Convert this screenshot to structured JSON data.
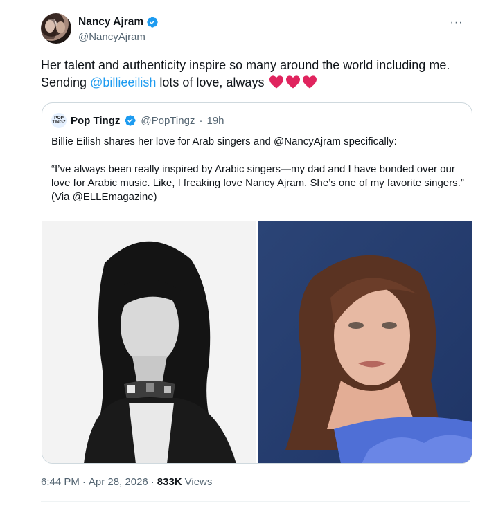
{
  "author": {
    "name": "Nancy Ajram",
    "handle": "@NancyAjram"
  },
  "tweet": {
    "text_before": "Her talent and authenticity inspire so many around the world including me. Sending ",
    "mention": "@billieeilish",
    "text_after": " lots of love, always",
    "emoji": [
      "heart",
      "heart",
      "heart"
    ]
  },
  "more_label": "···",
  "quote": {
    "avatar_text": "POP TINGZ",
    "name": "Pop Tingz",
    "handle": "@PopTingz",
    "separator": "·",
    "time": "19h",
    "line1": "Billie Eilish shares her love for Arab singers and @NancyAjram specifically:",
    "line2": "“I’ve always been really inspired by Arabic singers—my dad and I have bonded over our love for Arabic music. Like, I freaking love Nancy Ajram. She’s one of my favorite singers.” (Via @ELLEmagazine)"
  },
  "footer": {
    "time": "6:44 PM",
    "sep1": "·",
    "date": "Apr 28, 2026",
    "sep2": "·",
    "views_count": "833K",
    "views_label": "Views"
  },
  "colors": {
    "accent": "#1d9bf0",
    "heart": "#e0245e",
    "muted": "#536471",
    "border": "#cfd9de"
  }
}
